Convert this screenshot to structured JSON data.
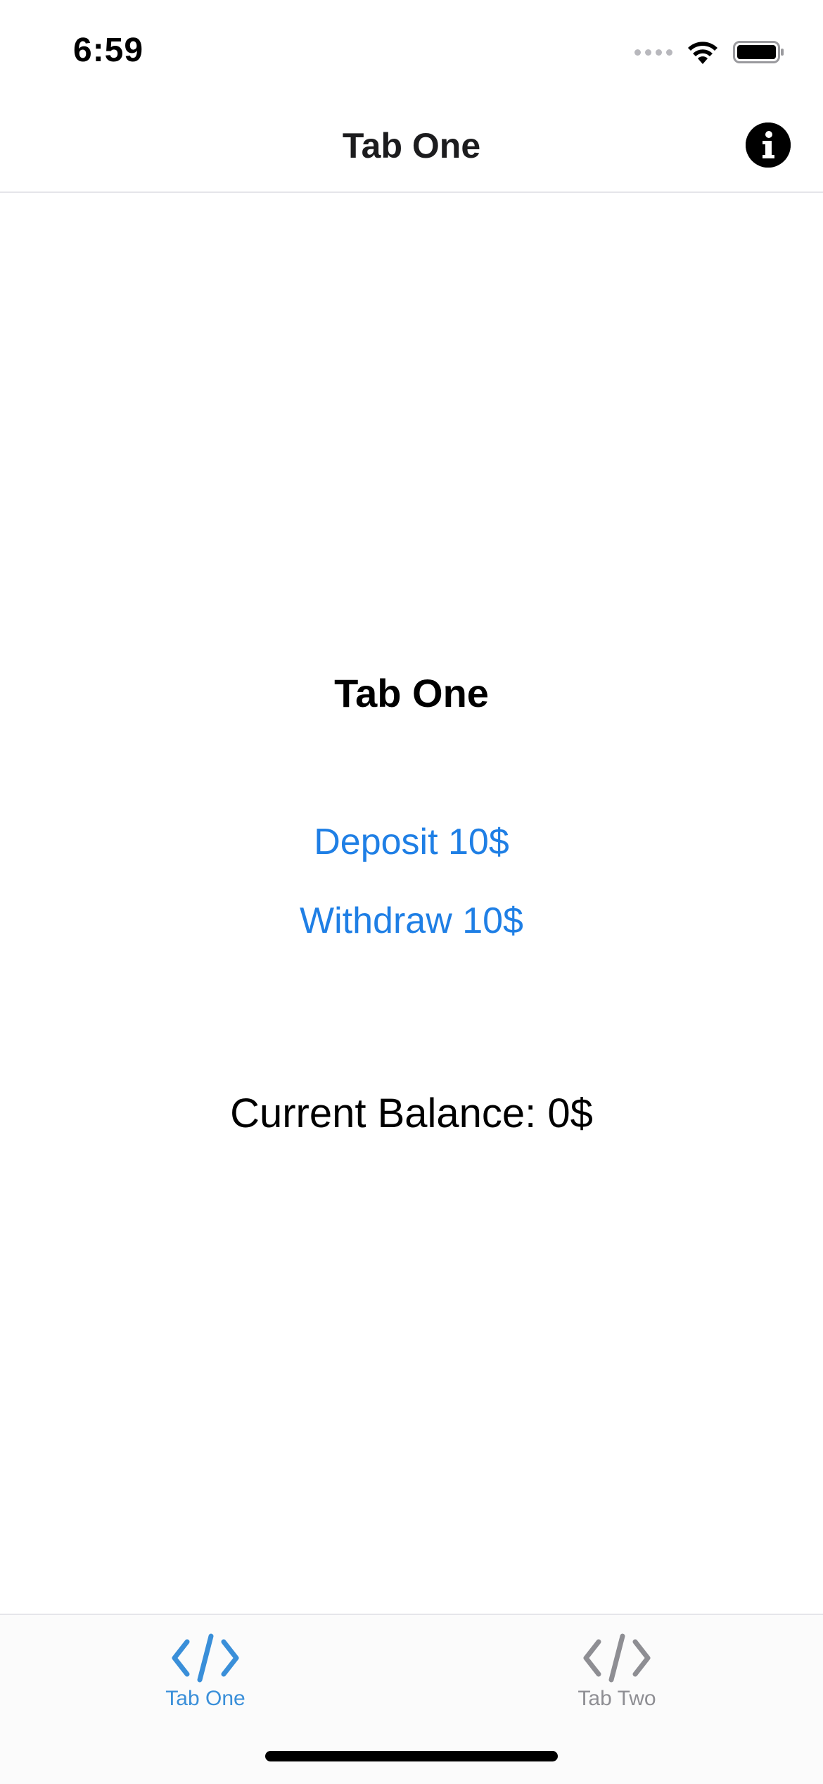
{
  "status_bar": {
    "time": "6:59"
  },
  "nav_bar": {
    "title": "Tab One",
    "info_icon": "info-circle-icon"
  },
  "content": {
    "title": "Tab One",
    "deposit_label": "Deposit 10$",
    "withdraw_label": "Withdraw 10$",
    "balance_text": "Current Balance: 0$"
  },
  "tab_bar": {
    "tabs": [
      {
        "label": "Tab One",
        "icon": "code-icon",
        "active": true
      },
      {
        "label": "Tab Two",
        "icon": "code-icon",
        "active": false
      }
    ]
  },
  "colors": {
    "accent": "#1f7fe5",
    "tab_active": "#3a8fd9",
    "tab_inactive": "#8e8e93"
  }
}
